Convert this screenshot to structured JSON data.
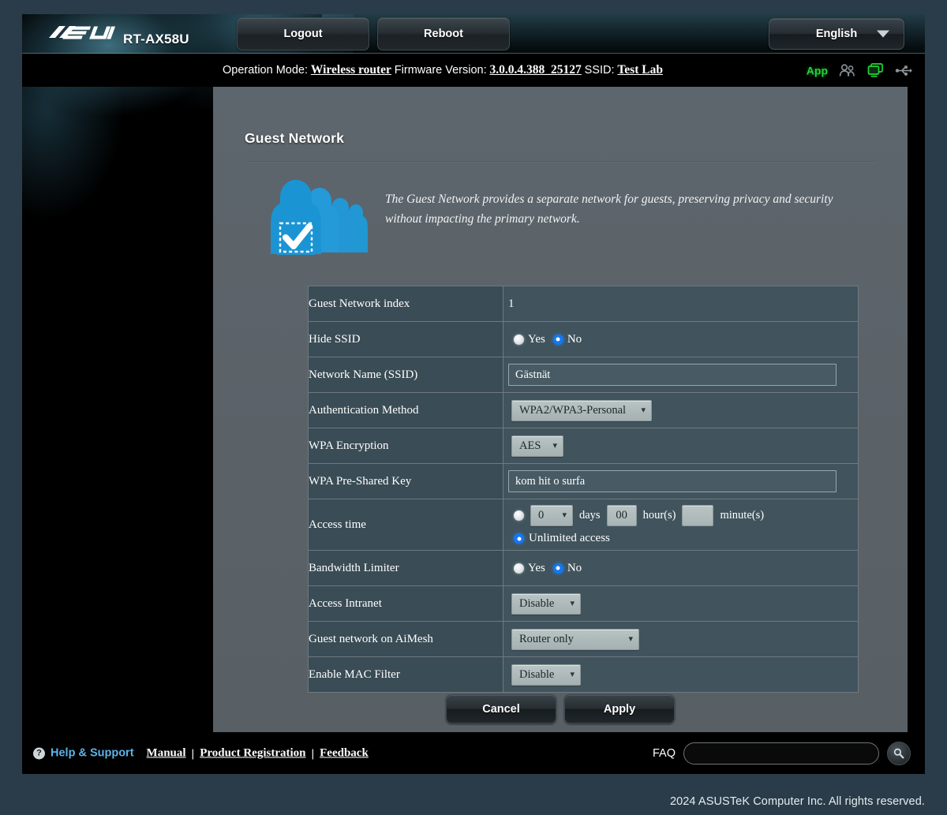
{
  "header": {
    "brand": "ASUS",
    "model": "RT-AX58U",
    "logout_label": "Logout",
    "reboot_label": "Reboot",
    "language": "English"
  },
  "info_bar": {
    "operation_mode_label": "Operation Mode:",
    "operation_mode_value": "Wireless router",
    "firmware_label": "Firmware Version:",
    "firmware_value": "3.0.0.4.388_25127",
    "ssid_label": "SSID:",
    "ssid_value": "Test Lab",
    "app_label": "App",
    "icons": [
      "app-text",
      "aimesh-users-icon",
      "monitor-icon",
      "usb-icon"
    ]
  },
  "page": {
    "title": "Guest Network",
    "description": "The Guest Network provides a separate network for guests, preserving privacy and security without impacting the primary network.",
    "illustration": "guest-users-check-icon"
  },
  "form": {
    "rows": {
      "index": {
        "label": "Guest Network index",
        "value": "1"
      },
      "hide_ssid": {
        "label": "Hide SSID",
        "yes": "Yes",
        "no": "No",
        "selected": "No"
      },
      "ssid": {
        "label": "Network Name (SSID)",
        "value": "Gästnät",
        "placeholder": ""
      },
      "auth": {
        "label": "Authentication Method",
        "value": "WPA2/WPA3-Personal"
      },
      "encryption": {
        "label": "WPA Encryption",
        "value": "AES"
      },
      "psk": {
        "label": "WPA Pre-Shared Key",
        "value": "kom hit o surfa",
        "placeholder": ""
      },
      "access_time": {
        "label": "Access time",
        "days_value": "0",
        "days_unit": "days",
        "hours_value": "00",
        "hours_unit": "hour(s)",
        "minutes_value": "",
        "minutes_unit": "minute(s)",
        "unlimited_label": "Unlimited access",
        "selected": "unlimited"
      },
      "bandwidth": {
        "label": "Bandwidth Limiter",
        "yes": "Yes",
        "no": "No",
        "selected": "No"
      },
      "intranet": {
        "label": "Access Intranet",
        "value": "Disable"
      },
      "aimesh": {
        "label": "Guest network on AiMesh",
        "value": "Router only"
      },
      "mac_filter": {
        "label": "Enable MAC Filter",
        "value": "Disable"
      }
    }
  },
  "actions": {
    "cancel_label": "Cancel",
    "apply_label": "Apply"
  },
  "footer": {
    "help_icon": "?",
    "help_label": "Help & Support",
    "manual_label": "Manual",
    "separator": "|",
    "product_registration_label": "Product Registration",
    "feedback_label": "Feedback",
    "faq_label": "FAQ",
    "faq_value": "",
    "faq_placeholder": "",
    "search_icon": "magnifier-icon"
  },
  "copyright": "2024 ASUSTeK Computer Inc. All rights reserved.",
  "colors": {
    "page_background": "#2a3c49",
    "panel": "#5a6369",
    "table_label_cell": "#3a4c55",
    "table_value_cell": "#41545d",
    "accent_blue": "#1478f0",
    "app_green": "#22d63a",
    "help_blue": "#5db4e8"
  }
}
